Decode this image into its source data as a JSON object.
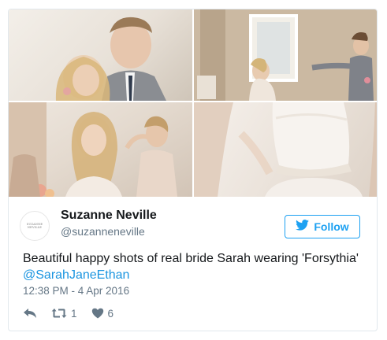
{
  "author": {
    "name": "Suzanne Neville",
    "handle": "@suzanneneville",
    "avatar_text": "SUZANNE NEVILLE"
  },
  "follow_button": {
    "label": "Follow",
    "icon": "twitter-bird-icon"
  },
  "tweet": {
    "text": "Beautiful happy shots of real bride Sarah wearing 'Forsythia'",
    "mention": "@SarahJaneEthan",
    "timestamp": "12:38 PM - 4 Apr 2016"
  },
  "actions": {
    "reply_icon": "reply-icon",
    "retweet_icon": "retweet-icon",
    "retweet_count": "1",
    "like_icon": "heart-icon",
    "like_count": "6"
  },
  "photos": [
    {
      "name": "photo-couple-laughing"
    },
    {
      "name": "photo-couple-holding-hands"
    },
    {
      "name": "photo-bride-hair-styling"
    },
    {
      "name": "photo-dress-detail"
    }
  ],
  "colors": {
    "accent": "#1da1f2",
    "mention": "#1b95e0",
    "text": "#14171a",
    "secondary": "#657786",
    "border": "#e1e8ed"
  }
}
